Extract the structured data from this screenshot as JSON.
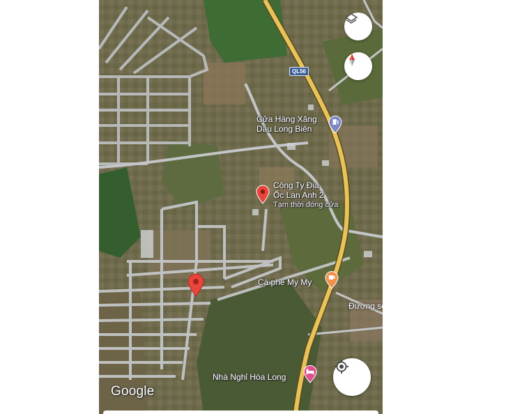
{
  "map": {
    "highway_shield": "QL56",
    "pois": [
      {
        "name_line1": "Cửa Hàng Xăng",
        "name_line2": "Dầu Long Biên",
        "icon": "gas-station-icon",
        "color": "#7b86c6"
      },
      {
        "name_line1": "Công Ty Địa",
        "name_line2": "Ốc Lan Anh 2",
        "status": "Tạm thời đóng cửa",
        "icon": "red-pin-icon",
        "color": "#e8453c"
      },
      {
        "name": "Cà phê My My",
        "icon": "coffee-icon",
        "color": "#f2914a"
      },
      {
        "name": "Nhà Nghỉ Hòa Long",
        "icon": "hotel-bed-icon",
        "color": "#e04f8f"
      }
    ],
    "road_label": "Đường số",
    "logo": "Google",
    "dropped_pin": "red-pin-icon"
  },
  "controls": {
    "layers": "layers-icon",
    "compass": "compass-icon",
    "my_location": "my-location-icon"
  }
}
